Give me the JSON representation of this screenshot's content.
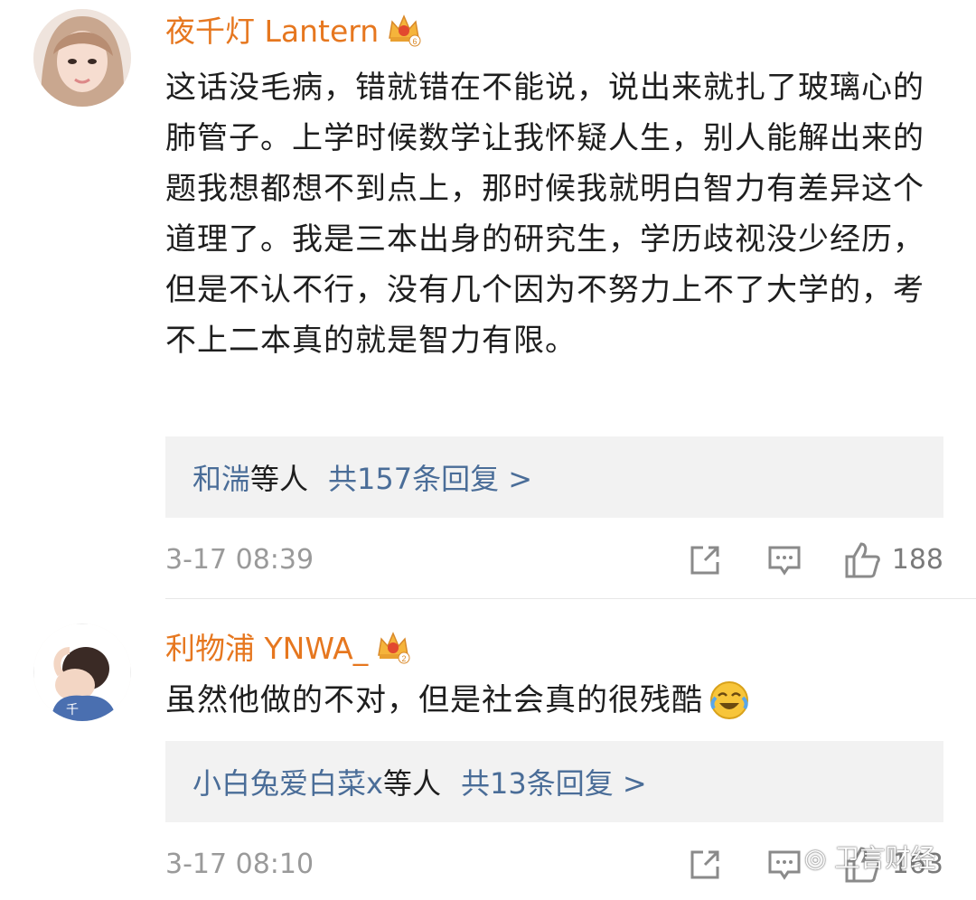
{
  "comments": [
    {
      "username": "夜千灯 Lantern",
      "badge": "6",
      "text": "这话没毛病，错就错在不能说，说出来就扎了玻璃心的肺管子。上学时候数学让我怀疑人生，别人能解出来的题我想都想不到点上，那时候我就明白智力有差异这个道理了。我是三本出身的研究生，学历歧视没少经历，但是不认不行，没有几个因为不努力上不了大学的，考不上二本真的就是智力有限。",
      "reply_users": "和湍",
      "reply_suffix": "等人",
      "reply_count": "共157条回复 >",
      "time": "3-17 08:39",
      "likes": "188"
    },
    {
      "username": "利物浦 YNWA_",
      "badge": "2",
      "text": "虽然他做的不对，但是社会真的很残酷",
      "reply_users": "小白兔爱白菜x",
      "reply_suffix": "等人",
      "reply_count": "共13条回复 >",
      "time": "3-17 08:10",
      "likes": "163"
    }
  ],
  "watermark": "卫言财经",
  "colors": {
    "username": "#e6771f",
    "link": "#4a6d98",
    "reply_bg": "#f2f2f2",
    "time": "#9a9a9a"
  }
}
